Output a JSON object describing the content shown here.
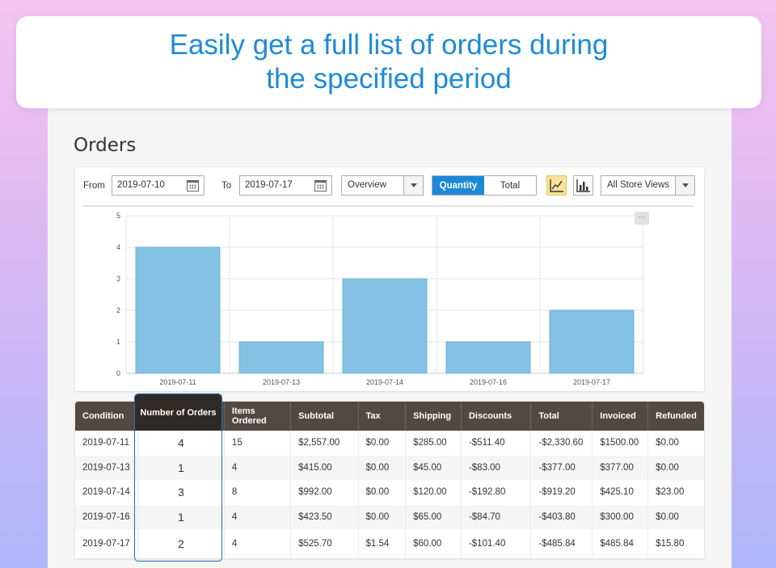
{
  "headline": {
    "line1": "Easily get a full list of orders during",
    "line2": "the specified period",
    "color": "#1e8bd6"
  },
  "page": {
    "title": "Orders"
  },
  "toolbar": {
    "from_label": "From",
    "from_value": "2019-07-10",
    "to_label": "To",
    "to_value": "2019-07-17",
    "view_select": "Overview",
    "metric_toggle": {
      "quantity": "Quantity",
      "total": "Total",
      "selected": "Quantity"
    },
    "store_select": "All Store Views",
    "line_chart_icon": "line-chart-icon",
    "bar_chart_icon": "bar-chart-icon",
    "calendar_icon": "calendar-icon"
  },
  "chart_data": {
    "type": "bar",
    "categories": [
      "2019-07-11",
      "2019-07-13",
      "2019-07-14",
      "2019-07-16",
      "2019-07-17"
    ],
    "values": [
      4,
      1,
      3,
      1,
      2
    ],
    "ylim": [
      0,
      5
    ],
    "yticks": [
      0,
      1,
      2,
      3,
      4,
      5
    ],
    "grid": true,
    "bar_color": "#83c2e3",
    "more_label": "···"
  },
  "table": {
    "columns": [
      "Condition",
      "Number of Orders",
      "Items  Ordered",
      "Subtotal",
      "Tax",
      "Shipping",
      "Discounts",
      "Total",
      "Invoiced",
      "Refunded"
    ],
    "rows": [
      [
        "2019-07-11",
        "4",
        "15",
        "$2,557.00",
        "$0.00",
        "$285.00",
        "-$511.40",
        "-$2,330.60",
        "$1500.00",
        "$0.00"
      ],
      [
        "2019-07-13",
        "1",
        "4",
        "$415.00",
        "$0.00",
        "$45.00",
        "-$83.00",
        "-$377.00",
        "$377.00",
        "$0.00"
      ],
      [
        "2019-07-14",
        "3",
        "8",
        "$992.00",
        "$0.00",
        "$120.00",
        "-$192.80",
        "-$919.20",
        "$425.10",
        "$23.00"
      ],
      [
        "2019-07-16",
        "1",
        "4",
        "$423.50",
        "$0.00",
        "$65.00",
        "-$84.70",
        "-$403.80",
        "$300.00",
        "$0.00"
      ],
      [
        "2019-07-17",
        "2",
        "4",
        "$525.70",
        "$1.54",
        "$60.00",
        "-$101.40",
        "-$485.84",
        "$485.84",
        "$15.80"
      ]
    ],
    "header_color": "#514943"
  }
}
